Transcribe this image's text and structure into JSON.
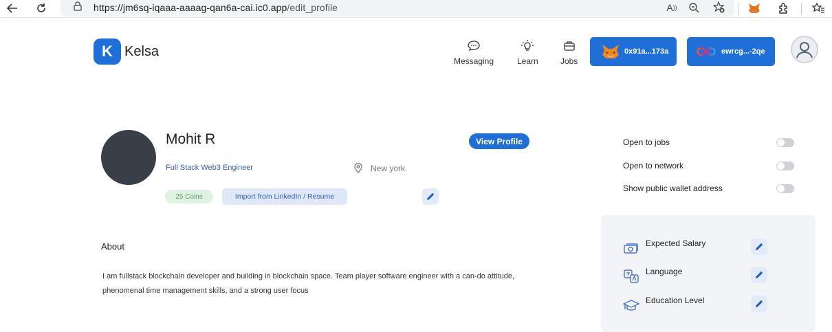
{
  "browser": {
    "url_host": "https://jm6sq-iqaaa-aaaag-qan6a-cai.ic0.app",
    "url_path": "/edit_profile"
  },
  "header": {
    "brand": "Kelsa",
    "logo_letter": "K",
    "nav": [
      {
        "label": "Messaging",
        "icon": "chat-icon"
      },
      {
        "label": "Learn",
        "icon": "lightbulb-icon"
      },
      {
        "label": "Jobs",
        "icon": "briefcase-icon"
      }
    ],
    "wallets": [
      {
        "label": "0x91a...173a",
        "icon": "metamask-fox-icon"
      },
      {
        "label": "ewrcg...-2qe",
        "icon": "infinity-icon"
      }
    ]
  },
  "profile": {
    "name": "Mohit R",
    "headline": "Full Stack Web3 Engineer",
    "location": "New york",
    "coins": "25 Coins",
    "import_label": "Import from LinkedIn / Resume",
    "view_profile_label": "View Profile"
  },
  "about": {
    "title": "About",
    "text": "I am fullstack blockchain developer and building in blockchain space. Team player software engineer with a can-do attitude, phenomenal time management skills, and a strong user focus"
  },
  "toggles": [
    {
      "label": "Open to jobs",
      "on": false
    },
    {
      "label": "Open to network",
      "on": false
    },
    {
      "label": "Show public wallet address",
      "on": false
    }
  ],
  "details": [
    {
      "label": "Expected Salary",
      "icon": "salary-icon"
    },
    {
      "label": "Language",
      "icon": "language-icon"
    },
    {
      "label": "Education Level",
      "icon": "graduation-cap-icon"
    }
  ],
  "colors": {
    "primary": "#1f6fd8",
    "avatar": "#3a3f47",
    "coins_bg": "#dff3e2",
    "panel_bg": "#f3f4f8"
  }
}
